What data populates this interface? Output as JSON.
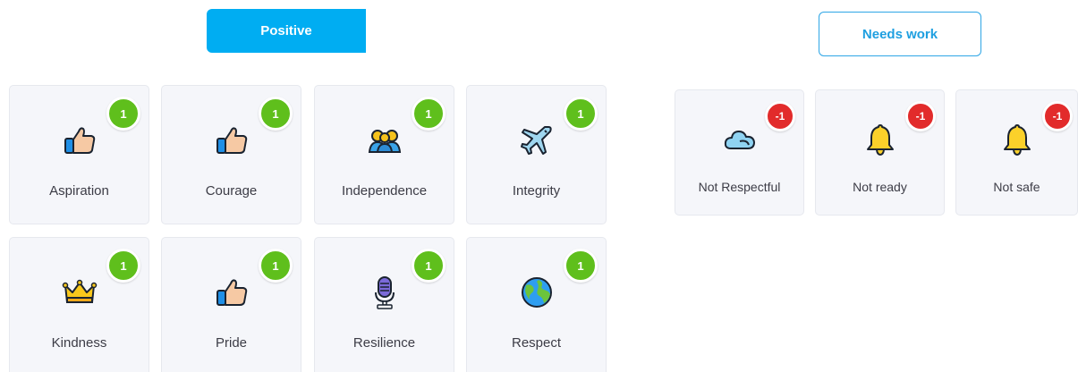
{
  "tabs": {
    "positive_label": "Positive",
    "needs_work_label": "Needs work"
  },
  "positive": [
    {
      "label": "Aspiration",
      "points": "1",
      "icon": "thumbs-up-icon"
    },
    {
      "label": "Courage",
      "points": "1",
      "icon": "thumbs-up-icon"
    },
    {
      "label": "Independence",
      "points": "1",
      "icon": "people-icon"
    },
    {
      "label": "Integrity",
      "points": "1",
      "icon": "airplane-icon"
    },
    {
      "label": "Kindness",
      "points": "1",
      "icon": "crown-icon"
    },
    {
      "label": "Pride",
      "points": "1",
      "icon": "thumbs-up-icon"
    },
    {
      "label": "Resilience",
      "points": "1",
      "icon": "microphone-icon"
    },
    {
      "label": "Respect",
      "points": "1",
      "icon": "globe-icon"
    }
  ],
  "needs_work": [
    {
      "label": "Not Respectful",
      "points": "-1",
      "icon": "cloud-icon"
    },
    {
      "label": "Not ready",
      "points": "-1",
      "icon": "bell-icon"
    },
    {
      "label": "Not safe",
      "points": "-1",
      "icon": "bell-icon"
    }
  ],
  "colors": {
    "positive_tab": "#00adf2",
    "needs_work_border": "#2ea6e6",
    "positive_badge": "#5fbf1c",
    "negative_badge": "#e22b2b",
    "card_background": "#f5f6fa"
  }
}
